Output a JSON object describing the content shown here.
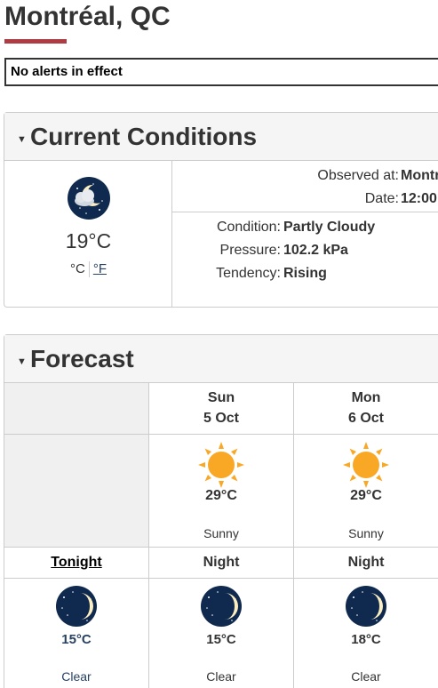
{
  "page": {
    "title": "Montréal, QC"
  },
  "alert": {
    "text": "No alerts in effect"
  },
  "current": {
    "heading": "Current Conditions",
    "icon": "night-partly-cloudy-icon",
    "temperature": "19°C",
    "unit_c": "°C",
    "unit_f": "°F",
    "observed_label": "Observed at:",
    "observed_value": "Montr",
    "date_label": "Date:",
    "date_value": "12:00",
    "condition_label": "Condition:",
    "condition_value": "Partly Cloudy",
    "pressure_label": "Pressure:",
    "pressure_value": "102.2 kPa",
    "tendency_label": "Tendency:",
    "tendency_value": "Rising"
  },
  "forecast": {
    "heading": "Forecast",
    "days": [
      {
        "name": "Sun",
        "date": "5 Oct",
        "icon": "sun-icon",
        "high": "29°C",
        "condition": "Sunny",
        "night_label": "Night",
        "night_icon": "moon-icon",
        "low": "15°C",
        "night_condition": "Clear"
      },
      {
        "name": "Mon",
        "date": "6 Oct",
        "icon": "sun-icon",
        "high": "29°C",
        "condition": "Sunny",
        "night_label": "Night",
        "night_icon": "moon-icon",
        "low": "18°C",
        "night_condition": "Clear"
      }
    ],
    "tonight": {
      "label": "Tonight",
      "icon": "moon-icon",
      "low": "15°C",
      "condition": "Clear"
    }
  },
  "colors": {
    "title_underline": "#af3c43",
    "link_blue": "#284162",
    "sun": "#f9a825",
    "night_sky": "#0f2a4e"
  }
}
